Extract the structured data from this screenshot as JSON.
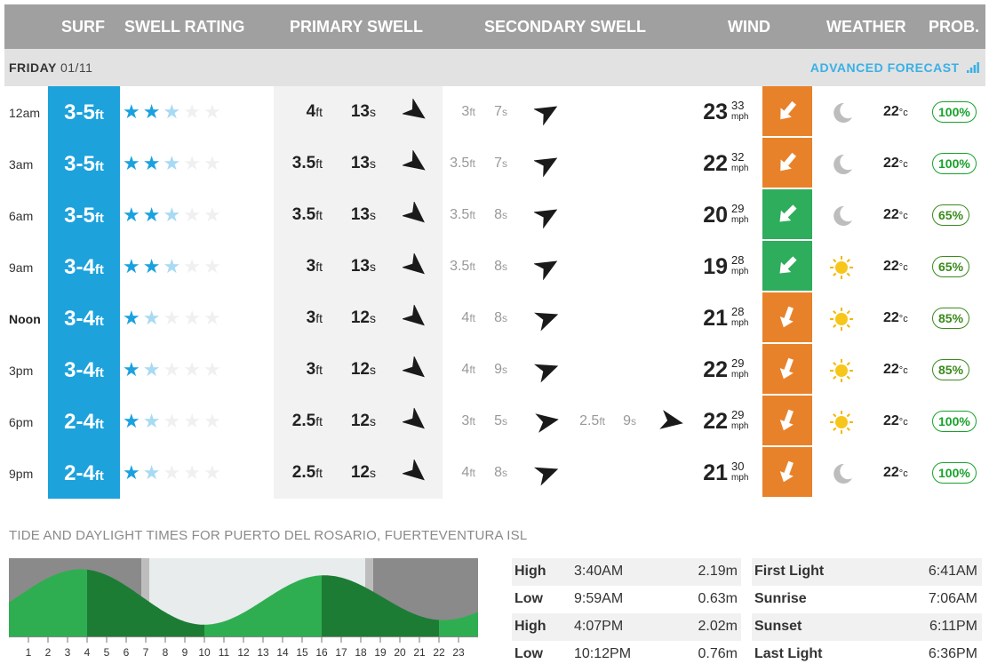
{
  "header": {
    "surf": "SURF",
    "swell_rating": "SWELL RATING",
    "primary_swell": "PRIMARY SWELL",
    "secondary_swell": "SECONDARY SWELL",
    "wind": "WIND",
    "weather": "WEATHER",
    "prob": "PROB."
  },
  "day": {
    "name": "FRIDAY",
    "date": "01/11",
    "advanced_forecast": "ADVANCED FORECAST"
  },
  "units": {
    "ft": "ft",
    "s": "s",
    "mph": "mph",
    "c": "°c"
  },
  "colors": {
    "surf_bg": "#1da2dc",
    "wind_offshore": "#2ead5c",
    "wind_cross": "#e8822a",
    "prob_high": "#17a22b",
    "prob_medium": "#3a8a1c"
  },
  "rows": [
    {
      "time": "12am",
      "bold": false,
      "surf": "3-5",
      "stars": [
        "full",
        "full",
        "half",
        "empty",
        "empty"
      ],
      "primary": {
        "height": "4",
        "period": "13",
        "dir": 125
      },
      "secondary": {
        "height": "3",
        "period": "7",
        "dir": 60
      },
      "tertiary": null,
      "wind": {
        "speed": "23",
        "gust": "33",
        "color": "cross",
        "dir": 40
      },
      "weather": "moon-icon",
      "temp": "22",
      "prob": "100%"
    },
    {
      "time": "3am",
      "bold": false,
      "surf": "3-5",
      "stars": [
        "full",
        "full",
        "half",
        "empty",
        "empty"
      ],
      "primary": {
        "height": "3.5",
        "period": "13",
        "dir": 125
      },
      "secondary": {
        "height": "3.5",
        "period": "7",
        "dir": 60
      },
      "tertiary": null,
      "wind": {
        "speed": "22",
        "gust": "32",
        "color": "cross",
        "dir": 40
      },
      "weather": "moon-icon",
      "temp": "22",
      "prob": "100%"
    },
    {
      "time": "6am",
      "bold": false,
      "surf": "3-5",
      "stars": [
        "full",
        "full",
        "half",
        "empty",
        "empty"
      ],
      "primary": {
        "height": "3.5",
        "period": "13",
        "dir": 130
      },
      "secondary": {
        "height": "3.5",
        "period": "8",
        "dir": 60
      },
      "tertiary": null,
      "wind": {
        "speed": "20",
        "gust": "29",
        "color": "offshore",
        "dir": 45
      },
      "weather": "moon-icon",
      "temp": "22",
      "prob": "65%"
    },
    {
      "time": "9am",
      "bold": false,
      "surf": "3-4",
      "stars": [
        "full",
        "full",
        "half",
        "empty",
        "empty"
      ],
      "primary": {
        "height": "3",
        "period": "13",
        "dir": 130
      },
      "secondary": {
        "height": "3.5",
        "period": "8",
        "dir": 60
      },
      "tertiary": null,
      "wind": {
        "speed": "19",
        "gust": "28",
        "color": "offshore",
        "dir": 45
      },
      "weather": "sun-icon",
      "temp": "22",
      "prob": "65%"
    },
    {
      "time": "Noon",
      "bold": true,
      "surf": "3-4",
      "stars": [
        "full",
        "half",
        "empty",
        "empty",
        "empty"
      ],
      "primary": {
        "height": "3",
        "period": "12",
        "dir": 130
      },
      "secondary": {
        "height": "4",
        "period": "8",
        "dir": 70
      },
      "tertiary": null,
      "wind": {
        "speed": "21",
        "gust": "28",
        "color": "cross",
        "dir": 20
      },
      "weather": "sun-icon",
      "temp": "22",
      "prob": "85%"
    },
    {
      "time": "3pm",
      "bold": false,
      "surf": "3-4",
      "stars": [
        "full",
        "half",
        "empty",
        "empty",
        "empty"
      ],
      "primary": {
        "height": "3",
        "period": "12",
        "dir": 130
      },
      "secondary": {
        "height": "4",
        "period": "9",
        "dir": 70
      },
      "tertiary": null,
      "wind": {
        "speed": "22",
        "gust": "29",
        "color": "cross",
        "dir": 20
      },
      "weather": "sun-icon",
      "temp": "22",
      "prob": "85%"
    },
    {
      "time": "6pm",
      "bold": false,
      "surf": "2-4",
      "stars": [
        "full",
        "half",
        "empty",
        "empty",
        "empty"
      ],
      "primary": {
        "height": "2.5",
        "period": "12",
        "dir": 130
      },
      "secondary": {
        "height": "3",
        "period": "5",
        "dir": 80
      },
      "tertiary": {
        "height": "2.5",
        "period": "9",
        "dir": 100
      },
      "wind": {
        "speed": "22",
        "gust": "29",
        "color": "cross",
        "dir": 20
      },
      "weather": "sun-icon",
      "temp": "22",
      "prob": "100%"
    },
    {
      "time": "9pm",
      "bold": false,
      "surf": "2-4",
      "stars": [
        "full",
        "half",
        "empty",
        "empty",
        "empty"
      ],
      "primary": {
        "height": "2.5",
        "period": "12",
        "dir": 130
      },
      "secondary": {
        "height": "4",
        "period": "8",
        "dir": 70
      },
      "tertiary": null,
      "wind": {
        "speed": "21",
        "gust": "30",
        "color": "cross",
        "dir": 20
      },
      "weather": "moon-icon",
      "temp": "22",
      "prob": "100%"
    }
  ],
  "tide": {
    "title": "TIDE AND DAYLIGHT TIMES FOR PUERTO DEL ROSARIO, FUERTEVENTURA ISL",
    "hours": [
      "1",
      "2",
      "3",
      "4",
      "5",
      "6",
      "7",
      "8",
      "9",
      "10",
      "11",
      "12",
      "13",
      "14",
      "15",
      "16",
      "17",
      "18",
      "19",
      "20",
      "21",
      "22",
      "23"
    ],
    "heights_m": [
      {
        "time": 3.67,
        "height": 2.19
      },
      {
        "time": 9.98,
        "height": 0.63
      },
      {
        "time": 16.12,
        "height": 2.02
      },
      {
        "time": 22.2,
        "height": 0.76
      }
    ],
    "table": [
      {
        "type": "High",
        "time": "3:40AM",
        "height": "2.19m"
      },
      {
        "type": "Low",
        "time": "9:59AM",
        "height": "0.63m"
      },
      {
        "type": "High",
        "time": "4:07PM",
        "height": "2.02m"
      },
      {
        "type": "Low",
        "time": "10:12PM",
        "height": "0.76m"
      }
    ]
  },
  "daylight": [
    {
      "label": "First Light",
      "time": "6:41AM"
    },
    {
      "label": "Sunrise",
      "time": "7:06AM"
    },
    {
      "label": "Sunset",
      "time": "6:11PM"
    },
    {
      "label": "Last Light",
      "time": "6:36PM"
    }
  ]
}
